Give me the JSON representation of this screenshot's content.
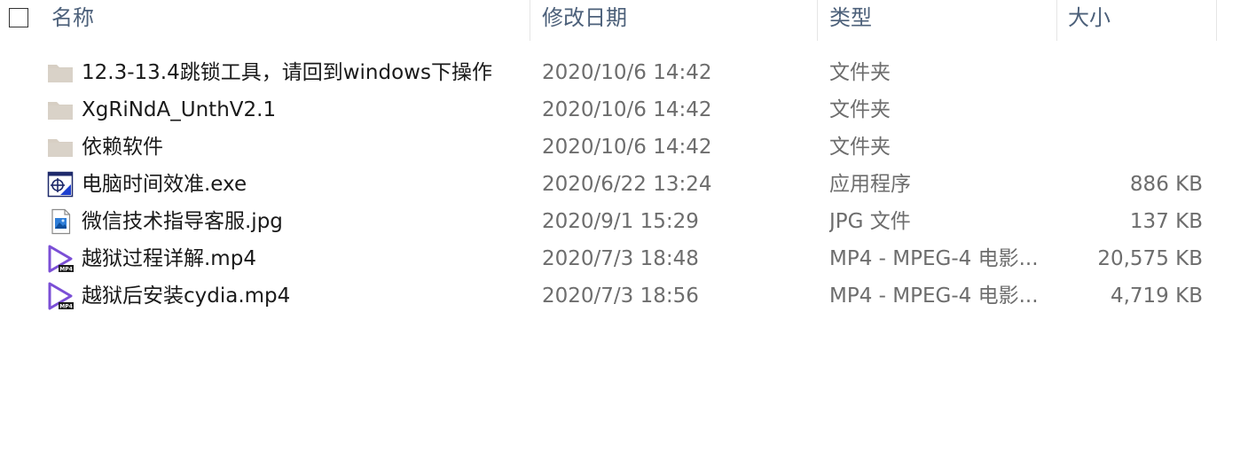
{
  "columns": {
    "name": "名称",
    "date": "修改日期",
    "type": "类型",
    "size": "大小"
  },
  "files": [
    {
      "icon": "folder-icon",
      "name": "12.3-13.4跳锁工具，请回到windows下操作",
      "date": "2020/10/6 14:42",
      "type": "文件夹",
      "size": ""
    },
    {
      "icon": "folder-icon",
      "name": "XgRiNdA_UnthV2.1",
      "date": "2020/10/6 14:42",
      "type": "文件夹",
      "size": ""
    },
    {
      "icon": "folder-icon",
      "name": "依赖软件",
      "date": "2020/10/6 14:42",
      "type": "文件夹",
      "size": ""
    },
    {
      "icon": "exe-icon",
      "name": "电脑时间效准.exe",
      "date": "2020/6/22 13:24",
      "type": "应用程序",
      "size": "886 KB"
    },
    {
      "icon": "image-file-icon",
      "name": "微信技术指导客服.jpg",
      "date": "2020/9/1 15:29",
      "type": "JPG 文件",
      "size": "137 KB"
    },
    {
      "icon": "mp4-video-icon",
      "name": "越狱过程详解.mp4",
      "date": "2020/7/3 18:48",
      "type": "MP4 - MPEG-4 电影...",
      "size": "20,575 KB"
    },
    {
      "icon": "mp4-video-icon",
      "name": "越狱后安装cydia.mp4",
      "date": "2020/7/3 18:56",
      "type": "MP4 - MPEG-4 电影...",
      "size": "4,719 KB"
    }
  ],
  "colors": {
    "header_text": "#4c607a",
    "name_text": "#1a1a1a",
    "meta_text": "#6d6d6d",
    "folder": "#d7cfc4",
    "video_icon": "#7b4fd6"
  }
}
